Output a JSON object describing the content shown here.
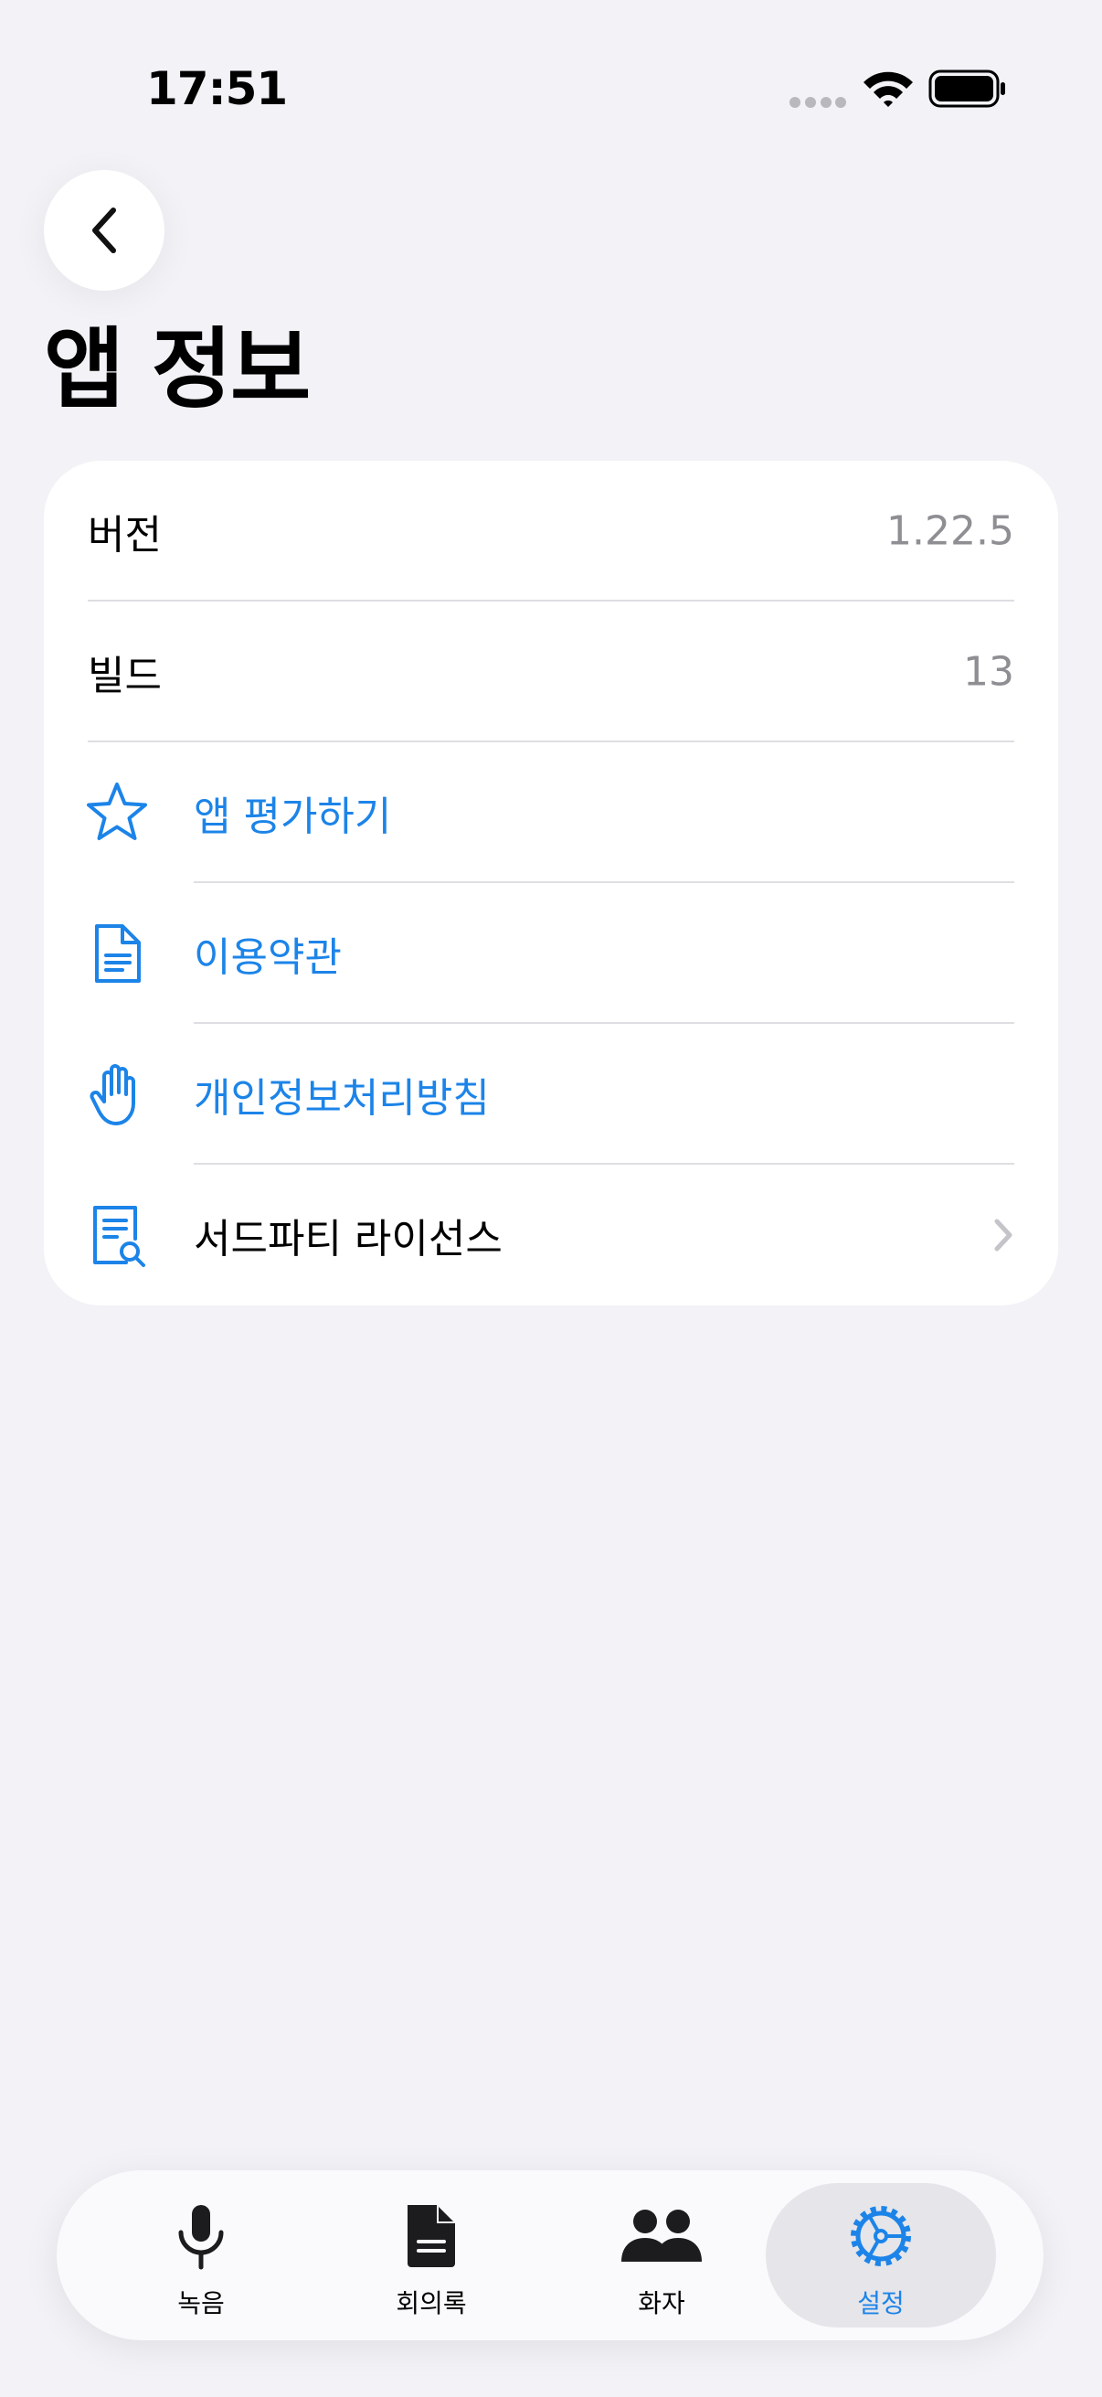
{
  "status": {
    "time": "17:51"
  },
  "page": {
    "title": "앱 정보"
  },
  "info": [
    {
      "label": "버전",
      "value": "1.22.5"
    },
    {
      "label": "빌드",
      "value": "13"
    }
  ],
  "links": [
    {
      "label": "앱 평가하기",
      "icon": "star-icon"
    },
    {
      "label": "이용약관",
      "icon": "document-icon"
    },
    {
      "label": "개인정보처리방침",
      "icon": "hand-icon"
    },
    {
      "label": "서드파티 라이선스",
      "icon": "document-search-icon"
    }
  ],
  "tabs": [
    {
      "label": "녹음",
      "icon": "microphone-icon",
      "active": false
    },
    {
      "label": "회의록",
      "icon": "document-fill-icon",
      "active": false
    },
    {
      "label": "화자",
      "icon": "people-icon",
      "active": false
    },
    {
      "label": "설정",
      "icon": "gear-icon",
      "active": true
    }
  ],
  "colors": {
    "accent": "#1c84e8",
    "background": "#f2f2f7",
    "card": "#ffffff",
    "secondary_text": "#8e8e93"
  }
}
